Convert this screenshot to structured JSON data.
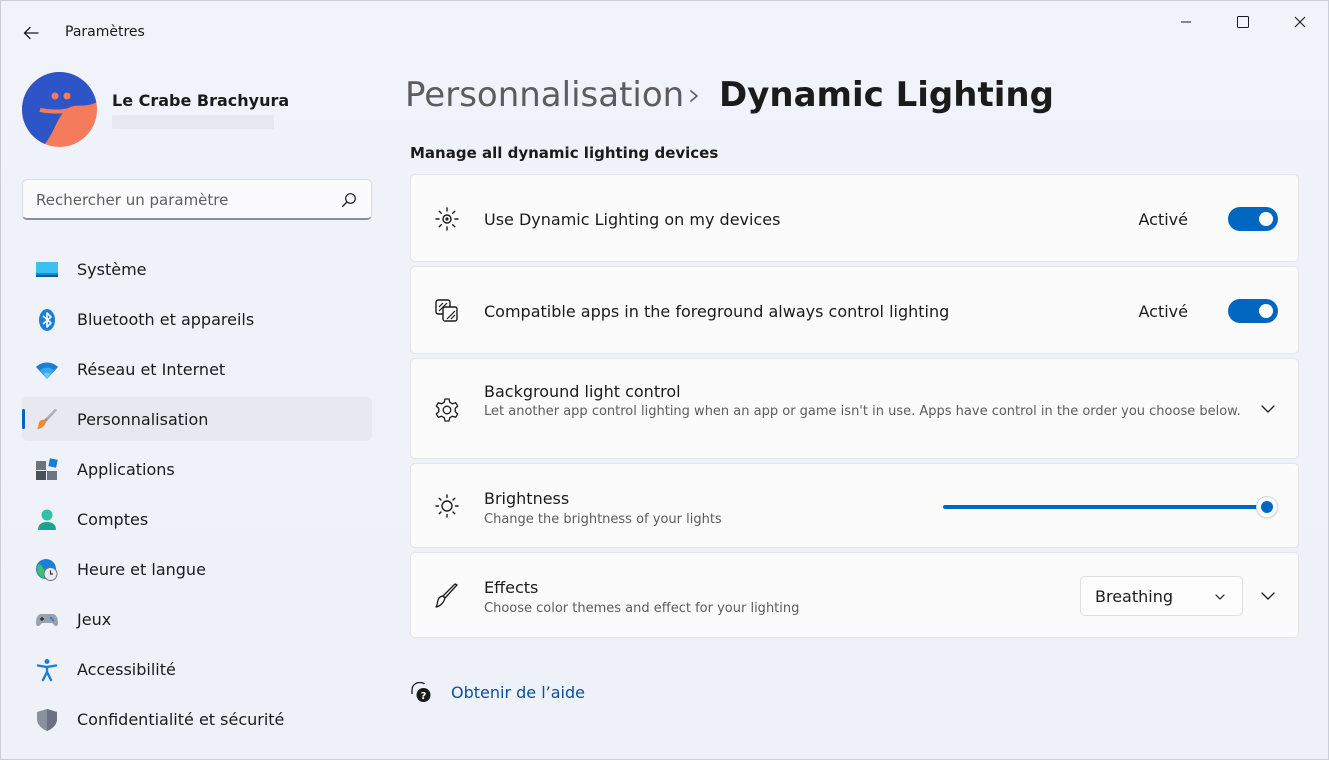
{
  "window": {
    "title": "Paramètres",
    "accent": "#0067c0"
  },
  "profile": {
    "name": "Le Crabe Brachyura"
  },
  "search": {
    "placeholder": "Rechercher un paramètre"
  },
  "sidebar": {
    "items": [
      {
        "label": "Système",
        "icon": "system-icon",
        "active": false
      },
      {
        "label": "Bluetooth et appareils",
        "icon": "bluetooth-icon",
        "active": false
      },
      {
        "label": "Réseau et Internet",
        "icon": "wifi-icon",
        "active": false
      },
      {
        "label": "Personnalisation",
        "icon": "paintbrush-icon",
        "active": true
      },
      {
        "label": "Applications",
        "icon": "apps-icon",
        "active": false
      },
      {
        "label": "Comptes",
        "icon": "account-icon",
        "active": false
      },
      {
        "label": "Heure et langue",
        "icon": "globe-clock-icon",
        "active": false
      },
      {
        "label": "Jeux",
        "icon": "gamepad-icon",
        "active": false
      },
      {
        "label": "Accessibilité",
        "icon": "accessibility-icon",
        "active": false
      },
      {
        "label": "Confidentialité et sécurité",
        "icon": "shield-icon",
        "active": false
      }
    ]
  },
  "breadcrumb": {
    "parent": "Personnalisation",
    "current": "Dynamic Lighting"
  },
  "main": {
    "section_title": "Manage all dynamic lighting devices",
    "use_dynamic": {
      "title": "Use Dynamic Lighting on my devices",
      "status": "Activé",
      "enabled": true
    },
    "compatible_apps": {
      "title": "Compatible apps in the foreground always control lighting",
      "status": "Activé",
      "enabled": true
    },
    "background": {
      "title": "Background light control",
      "subtitle": "Let another app control lighting when an app or game isn't in use. Apps have control in the order you choose below."
    },
    "brightness": {
      "title": "Brightness",
      "subtitle": "Change the brightness of your lights",
      "value": 1.0
    },
    "effects": {
      "title": "Effects",
      "subtitle": "Choose color themes and effect for your lighting",
      "selected": "Breathing"
    }
  },
  "help": {
    "label": "Obtenir de l’aide"
  }
}
